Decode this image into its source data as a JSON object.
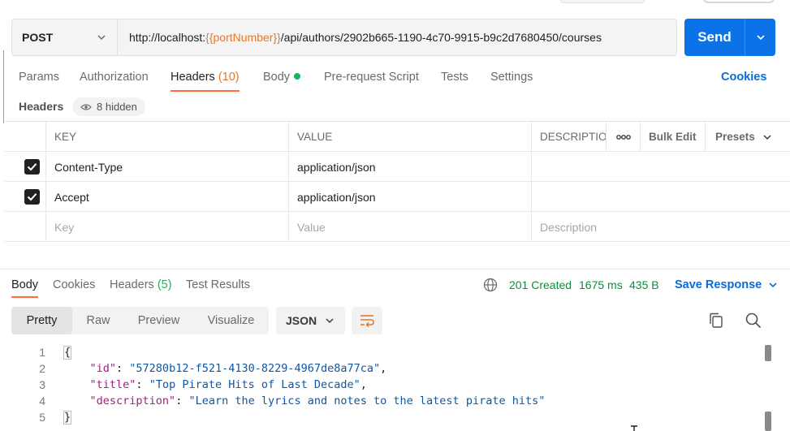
{
  "request": {
    "method": "POST",
    "url_prefix": "http://localhost:",
    "url_variable": "{{portNumber}}",
    "url_suffix": "/api/authors/2902b665-1190-4c70-9915-b9c2d7680450/courses",
    "send_label": "Send"
  },
  "request_tabs": {
    "params": "Params",
    "authorization": "Authorization",
    "headers": "Headers",
    "headers_count": "(10)",
    "body": "Body",
    "pre_request": "Pre-request Script",
    "tests": "Tests",
    "settings": "Settings",
    "cookies": "Cookies"
  },
  "headers_section": {
    "title": "Headers",
    "hidden_label": "8 hidden",
    "columns": {
      "key": "KEY",
      "value": "VALUE",
      "description": "DESCRIPTIO",
      "bulk_edit": "Bulk Edit",
      "presets": "Presets"
    },
    "rows": [
      {
        "key": "Content-Type",
        "value": "application/json",
        "checked": true
      },
      {
        "key": "Accept",
        "value": "application/json",
        "checked": true
      }
    ],
    "placeholders": {
      "key": "Key",
      "value": "Value",
      "description": "Description"
    }
  },
  "response": {
    "tabs": {
      "body": "Body",
      "cookies": "Cookies",
      "headers": "Headers",
      "headers_count": "(5)",
      "test_results": "Test Results"
    },
    "status": "201 Created",
    "time": "1675 ms",
    "size": "435 B",
    "save_label": "Save Response",
    "views": [
      "Pretty",
      "Raw",
      "Preview",
      "Visualize"
    ],
    "format": "JSON",
    "line_numbers": [
      "1",
      "2",
      "3",
      "4",
      "5"
    ],
    "json": {
      "open": "{",
      "close": "}",
      "id_key": "\"id\"",
      "id_val": "\"57280b12-f521-4130-8229-4967de8a77ca\"",
      "title_key": "\"title\"",
      "title_val": "\"Top Pirate Hits of Last Decade\"",
      "desc_key": "\"description\"",
      "desc_val": "\"Learn the lyrics and notes to the latest pirate hits\""
    }
  },
  "colors": {
    "accent": "#ff6c37",
    "primary": "#0c72e8",
    "variable": "#e5772e",
    "success": "#0cbb52"
  }
}
